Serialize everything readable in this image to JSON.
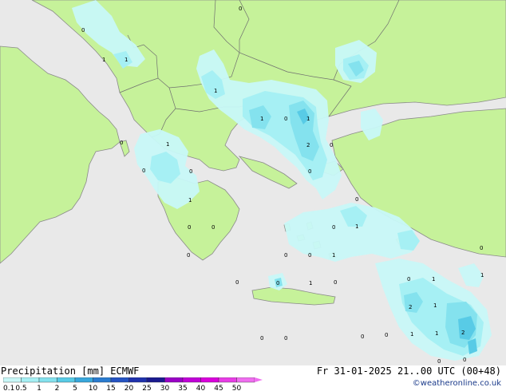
{
  "map": {
    "legend_title": "Precipitation [mm]",
    "model": "ECMWF",
    "valid_time": "Fr 31-01-2025 21..00 UTC (00+48)",
    "credit": "©weatheronline.co.uk",
    "colors": {
      "sea": "#e9e9e9",
      "land": "#c6f29a",
      "coast": "#8a8a8a",
      "border": "#6f6f6f"
    },
    "scale": {
      "labels": [
        "0.1",
        "0.5",
        "1",
        "2",
        "5",
        "10",
        "15",
        "20",
        "25",
        "30",
        "35",
        "40",
        "45",
        "50"
      ],
      "colors": [
        "#c8f8f8",
        "#a6f0f4",
        "#84e2ee",
        "#58cbe6",
        "#38a7dc",
        "#2a7cd0",
        "#2453c2",
        "#1f32ad",
        "#1a1a8f",
        "#9a00c6",
        "#c000d8",
        "#da00dc",
        "#e83ce6",
        "#f06ef0"
      ]
    },
    "values": [
      "0",
      "0",
      "1",
      "1",
      "1",
      "0",
      "1",
      "2",
      "0",
      "0",
      "1",
      "0",
      "0",
      "0",
      "1",
      "0",
      "0",
      "0",
      "1",
      "0",
      "0",
      "0",
      "0",
      "1",
      "0",
      "1",
      "0",
      "0",
      "1",
      "1",
      "0",
      "0",
      "0",
      "1",
      "2",
      "1",
      "0",
      "0",
      "1",
      "0",
      "0",
      "1",
      "2",
      "0"
    ]
  }
}
